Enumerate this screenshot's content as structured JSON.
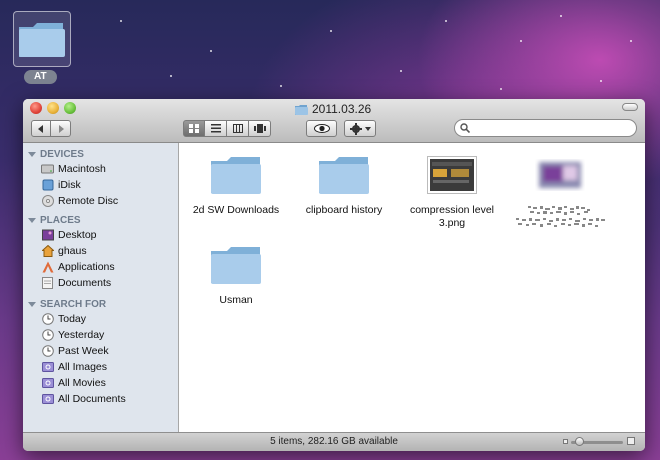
{
  "desktop": {
    "icon_label": "AT"
  },
  "window": {
    "title": "2011.03.26",
    "search": {
      "value": "",
      "placeholder": ""
    }
  },
  "sidebar": {
    "sections": [
      {
        "heading": "DEVICES",
        "items": [
          {
            "label": "Macintosh",
            "icon": "hard-drive-icon"
          },
          {
            "label": "iDisk",
            "icon": "idisk-icon"
          },
          {
            "label": "Remote Disc",
            "icon": "optical-disc-icon"
          }
        ]
      },
      {
        "heading": "PLACES",
        "items": [
          {
            "label": "Desktop",
            "icon": "desktop-icon"
          },
          {
            "label": "ghaus",
            "icon": "home-icon"
          },
          {
            "label": "Applications",
            "icon": "applications-icon"
          },
          {
            "label": "Documents",
            "icon": "documents-icon"
          }
        ]
      },
      {
        "heading": "SEARCH FOR",
        "items": [
          {
            "label": "Today",
            "icon": "clock-icon"
          },
          {
            "label": "Yesterday",
            "icon": "clock-icon"
          },
          {
            "label": "Past Week",
            "icon": "clock-icon"
          },
          {
            "label": "All Images",
            "icon": "smart-folder-icon"
          },
          {
            "label": "All Movies",
            "icon": "smart-folder-icon"
          },
          {
            "label": "All Documents",
            "icon": "smart-folder-icon"
          }
        ]
      }
    ]
  },
  "files": [
    {
      "name": "2d SW Downloads",
      "kind": "folder"
    },
    {
      "name": "clipboard history",
      "kind": "folder"
    },
    {
      "name": "compression level 3.png",
      "kind": "image"
    },
    {
      "name": "",
      "kind": "blurred-image"
    },
    {
      "name": "Usman",
      "kind": "folder"
    }
  ],
  "status": {
    "text": "5 items, 282.16 GB available"
  },
  "colors": {
    "folder": "#8fb8db",
    "sidebar_bg": "#dfe5ed"
  }
}
